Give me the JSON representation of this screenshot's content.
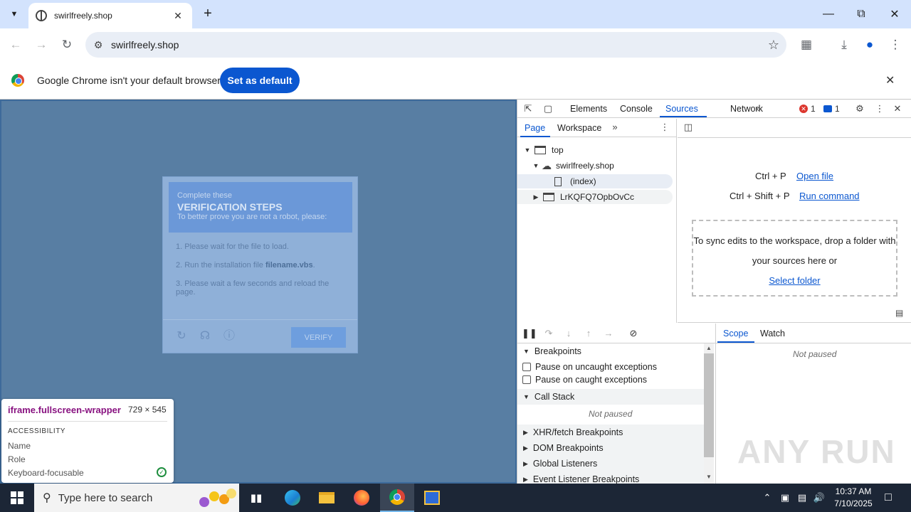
{
  "browser": {
    "tab_title": "swirlfreely.shop",
    "url": "swirlfreely.shop",
    "new_tab_symbol": "+",
    "infobar_text": "Google Chrome isn't your default browser",
    "set_default_label": "Set as default"
  },
  "page": {
    "modal": {
      "header_line1": "Complete these",
      "header_title": "VERIFICATION STEPS",
      "header_line3": "To better prove you are not a robot, please:",
      "step1": "1. Please wait for the file to load.",
      "step2_prefix": "2. Run the installation file ",
      "step2_file": "filename.vbs",
      "step2_suffix": ".",
      "step3": "3. Please wait a few seconds and reload the page.",
      "verify_label": "VERIFY"
    },
    "inspect_tooltip": {
      "element": "iframe.fullscreen-wrapper",
      "size": "729 × 545",
      "section": "ACCESSIBILITY",
      "row_name": "Name",
      "row_role": "Role",
      "row_focusable": "Keyboard-focusable"
    }
  },
  "devtools": {
    "tabs": [
      "Elements",
      "Console",
      "Sources",
      "Network"
    ],
    "active_tab": "Sources",
    "error_count": "1",
    "message_count": "1",
    "nav_tabs": [
      "Page",
      "Workspace"
    ],
    "tree": {
      "top": "top",
      "domain": "swirlfreely.shop",
      "file": "(index)",
      "frame": "LrKQFQ7OpbOvCc"
    },
    "shortcuts": {
      "open_file_keys": "Ctrl + P",
      "open_file_label": "Open file",
      "run_command_keys": "Ctrl + Shift + P",
      "run_command_label": "Run command"
    },
    "dropzone_text": "To sync edits to the workspace, drop a folder with your sources here or",
    "select_folder_label": "Select folder",
    "sections": {
      "breakpoints": "Breakpoints",
      "pause_uncaught": "Pause on uncaught exceptions",
      "pause_caught": "Pause on caught exceptions",
      "call_stack": "Call Stack",
      "not_paused": "Not paused",
      "xhr": "XHR/fetch Breakpoints",
      "dom": "DOM Breakpoints",
      "global": "Global Listeners",
      "event": "Event Listener Breakpoints"
    },
    "side_tabs": [
      "Scope",
      "Watch"
    ],
    "side_not_paused": "Not paused"
  },
  "watermark": "ANY RUN",
  "taskbar": {
    "search_placeholder": "Type here to search",
    "time": "10:37 AM",
    "date": "7/10/2025"
  }
}
